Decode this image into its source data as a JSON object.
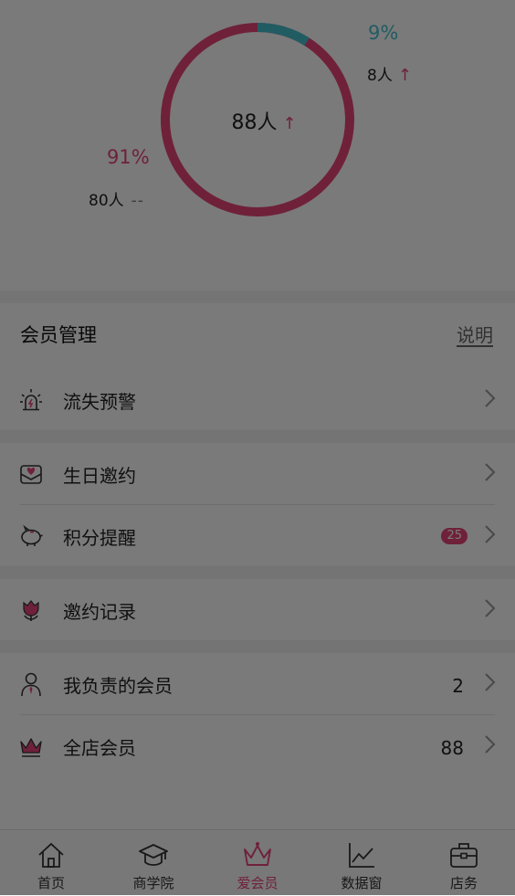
{
  "colors": {
    "accent": "#e8457a",
    "secondary": "#46c1cf"
  },
  "summary": {
    "total": "88人",
    "new": {
      "percent": "9%",
      "count": "8人",
      "share": 0.09
    },
    "old": {
      "percent": "91%",
      "count": "80人",
      "share": 0.91,
      "trend": "--"
    }
  },
  "section": {
    "title": "会员管理",
    "link": "说明"
  },
  "menu": {
    "churn": {
      "label": "流失预警",
      "icon": "alarm-light-icon"
    },
    "birthday": {
      "label": "生日邀约",
      "icon": "envelope-heart-icon"
    },
    "points": {
      "label": "积分提醒",
      "icon": "piggy-bank-icon",
      "badge": "25"
    },
    "invites": {
      "label": "邀约记录",
      "icon": "tulip-flower-icon"
    },
    "mine": {
      "label": "我负责的会员",
      "icon": "person-tie-icon",
      "value": "2"
    },
    "all": {
      "label": "全店会员",
      "icon": "crown-icon",
      "value": "88"
    }
  },
  "tabs": [
    {
      "label": "首页",
      "icon": "home-icon"
    },
    {
      "label": "商学院",
      "icon": "graduation-cap-icon"
    },
    {
      "label": "爱会员",
      "icon": "crown-icon",
      "active": true
    },
    {
      "label": "数据窗",
      "icon": "line-chart-icon"
    },
    {
      "label": "店务",
      "icon": "briefcase-icon"
    }
  ]
}
